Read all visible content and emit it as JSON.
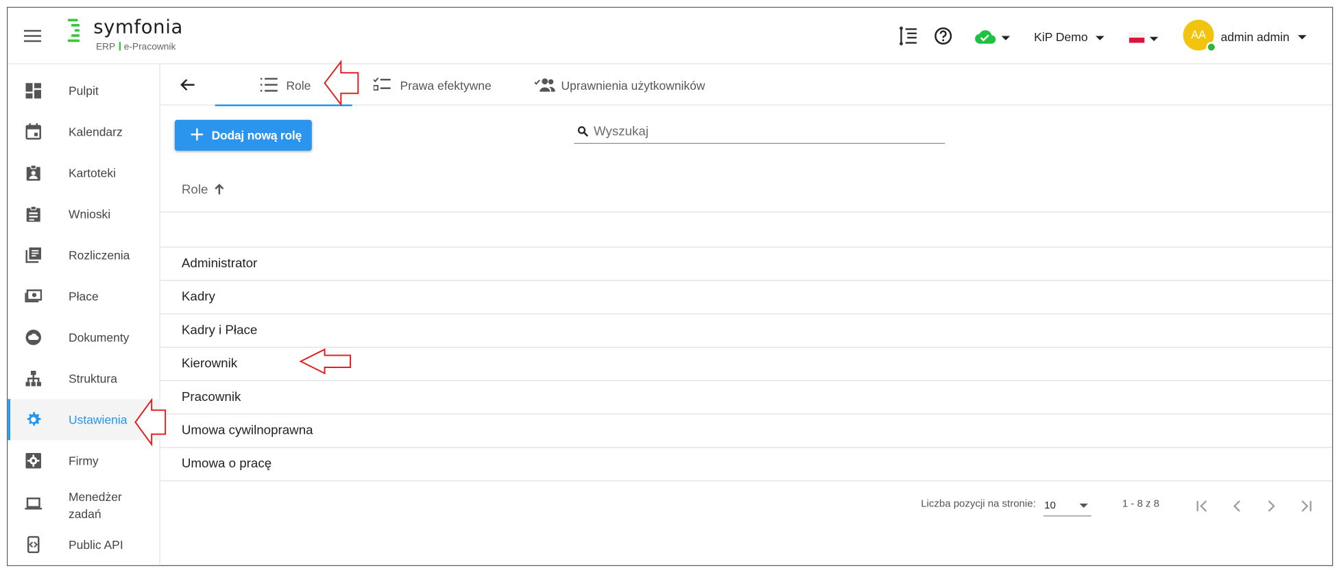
{
  "header": {
    "logo_name": "symfonia",
    "logo_sub_left": "ERP",
    "logo_sub_right": "e-Pracownik",
    "company": "KiP Demo",
    "avatar_initials": "AA",
    "user_name": "admin admin",
    "cloud_status_color": "#1ec23f"
  },
  "sidebar": {
    "items": [
      {
        "label": "Pulpit",
        "icon": "dashboard-icon"
      },
      {
        "label": "Kalendarz",
        "icon": "calendar-icon"
      },
      {
        "label": "Kartoteki",
        "icon": "badge-icon"
      },
      {
        "label": "Wnioski",
        "icon": "clipboard-icon"
      },
      {
        "label": "Rozliczenia",
        "icon": "ledger-icon"
      },
      {
        "label": "Płace",
        "icon": "payments-icon"
      },
      {
        "label": "Dokumenty",
        "icon": "cloud-icon"
      },
      {
        "label": "Struktura",
        "icon": "org-chart-icon"
      },
      {
        "label": "Ustawienia",
        "icon": "gear-icon"
      },
      {
        "label": "Firmy",
        "icon": "settings-box-icon"
      },
      {
        "label": "Menedżer zadań",
        "icon": "laptop-icon"
      },
      {
        "label": "Public API",
        "icon": "api-icon"
      }
    ]
  },
  "tabs": [
    {
      "label": "Role"
    },
    {
      "label": "Prawa efektywne"
    },
    {
      "label": "Uprawnienia użytkowników"
    }
  ],
  "toolbar": {
    "add_label": "Dodaj nową rolę",
    "search_placeholder": "Wyszukaj"
  },
  "table": {
    "column_header": "Role",
    "rows": [
      "",
      "Administrator",
      "Kadry",
      "Kadry i Płace",
      "Kierownik",
      "Pracownik",
      "Umowa cywilnoprawna",
      "Umowa o pracę"
    ]
  },
  "pagination": {
    "per_page_label": "Liczba pozycji na stronie:",
    "per_page_value": "10",
    "range": "1 - 8 z 8"
  },
  "colors": {
    "accent": "#2196f3",
    "brand_green": "#38c93b",
    "annotation": "#e02020"
  }
}
